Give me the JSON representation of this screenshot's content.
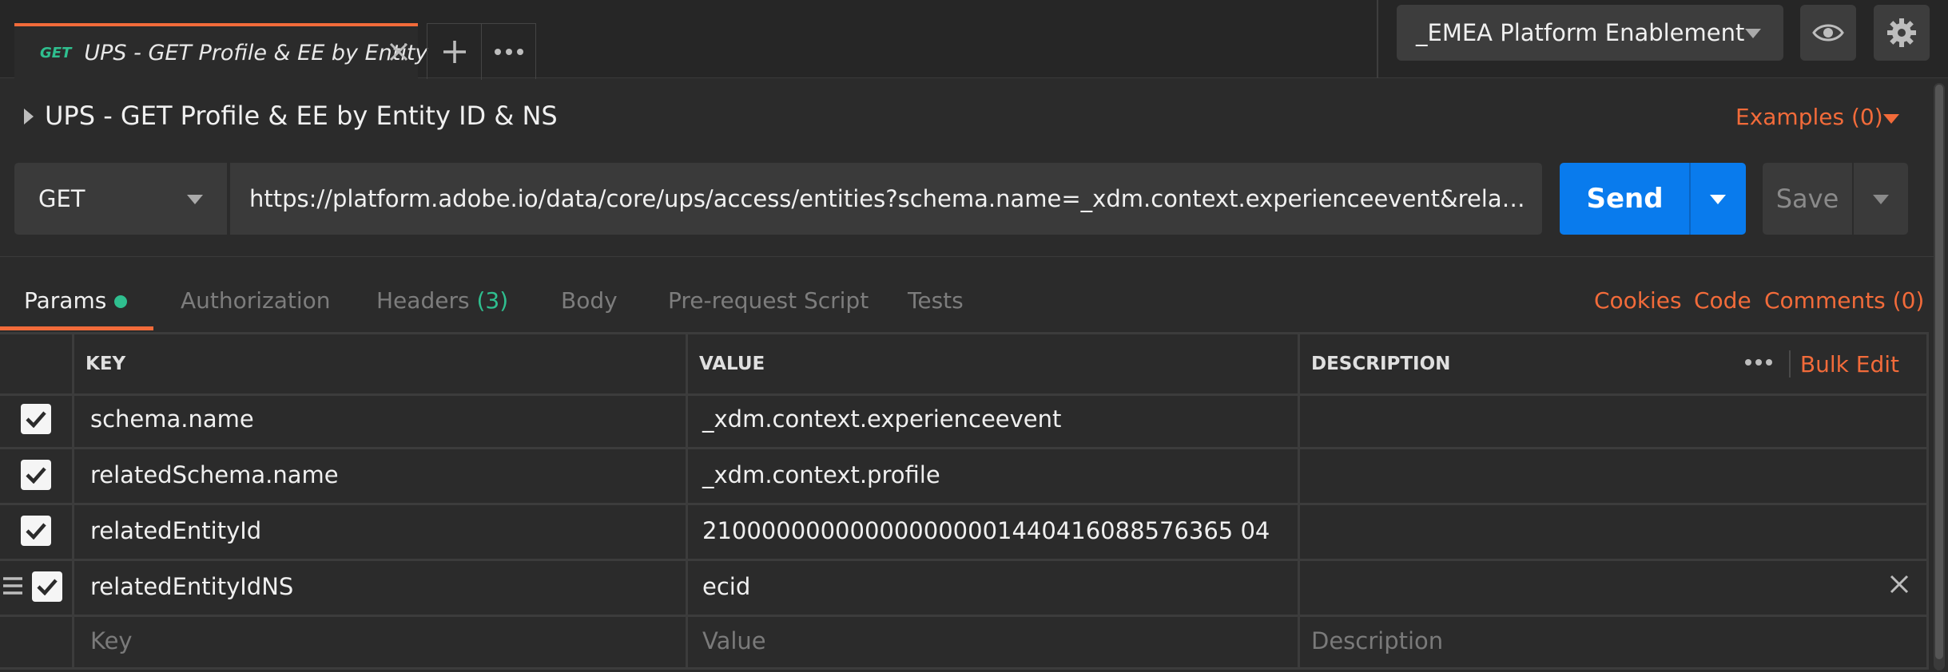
{
  "tab": {
    "method": "GET",
    "title": "UPS - GET Profile & EE by Entity"
  },
  "environment": {
    "selected": "_EMEA Platform Enablement"
  },
  "request": {
    "name": "UPS - GET Profile & EE by Entity ID & NS",
    "examples_label": "Examples (0)",
    "method": "GET",
    "url": "https://platform.adobe.io/data/core/ups/access/entities?schema.name=_xdm.context.experienceevent&relatedSchema.na..."
  },
  "buttons": {
    "send": "Send",
    "save": "Save"
  },
  "request_tabs": {
    "params": "Params",
    "authorization": "Authorization",
    "headers": "Headers",
    "headers_count": "(3)",
    "body": "Body",
    "prerequest": "Pre-request Script",
    "tests": "Tests"
  },
  "links": {
    "cookies": "Cookies",
    "code": "Code",
    "comments": "Comments (0)"
  },
  "table": {
    "columns": {
      "key": "KEY",
      "value": "VALUE",
      "description": "DESCRIPTION"
    },
    "bulk_edit": "Bulk Edit",
    "rows": [
      {
        "key": "schema.name",
        "value": "_xdm.context.experienceevent",
        "description": "",
        "checked": true
      },
      {
        "key": "relatedSchema.name",
        "value": "_xdm.context.profile",
        "description": "",
        "checked": true
      },
      {
        "key": "relatedEntityId",
        "value": "210000000000000000001440416088576365 04",
        "description": "",
        "checked": true
      },
      {
        "key": "relatedEntityIdNS",
        "value": "ecid",
        "description": "",
        "checked": true
      }
    ],
    "placeholders": {
      "key": "Key",
      "value": "Value",
      "description": "Description"
    }
  },
  "colors": {
    "accent": "#f26b3a",
    "send": "#097bed",
    "green": "#2fbf8f"
  }
}
